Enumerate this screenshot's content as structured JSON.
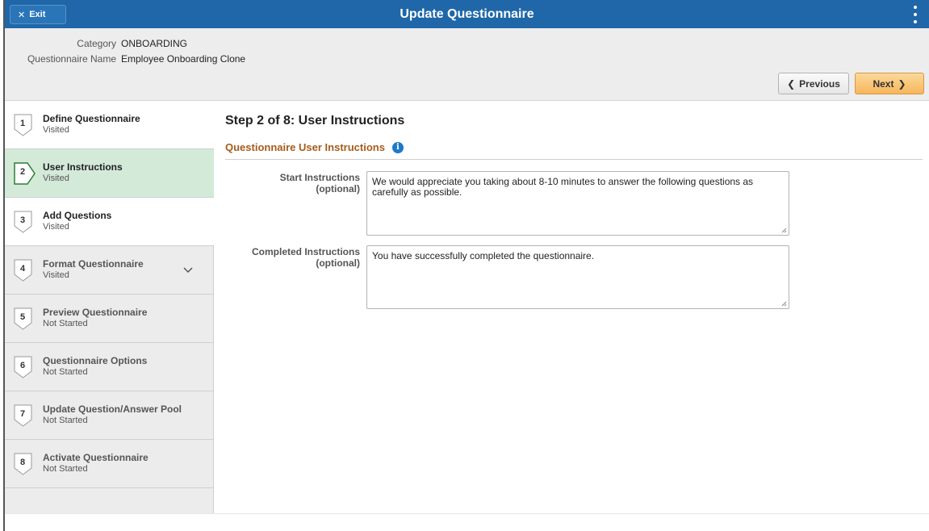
{
  "app": {
    "title": "Update Questionnaire",
    "exit_label": "Exit"
  },
  "header": {
    "category_label": "Category",
    "category_value": "ONBOARDING",
    "name_label": "Questionnaire Name",
    "name_value": "Employee Onboarding Clone"
  },
  "nav": {
    "previous_label": "Previous",
    "next_label": "Next"
  },
  "steps": [
    {
      "number": "1",
      "title": "Define Questionnaire",
      "status": "Visited"
    },
    {
      "number": "2",
      "title": "User Instructions",
      "status": "Visited"
    },
    {
      "number": "3",
      "title": "Add Questions",
      "status": "Visited"
    },
    {
      "number": "4",
      "title": "Format Questionnaire",
      "status": "Visited"
    },
    {
      "number": "5",
      "title": "Preview Questionnaire",
      "status": "Not Started"
    },
    {
      "number": "6",
      "title": "Questionnaire Options",
      "status": "Not Started"
    },
    {
      "number": "7",
      "title": "Update Question/Answer Pool",
      "status": "Not Started"
    },
    {
      "number": "8",
      "title": "Activate Questionnaire",
      "status": "Not Started"
    }
  ],
  "main": {
    "heading": "Step 2 of 8: User Instructions",
    "section_title": "Questionnaire User Instructions",
    "start_label": "Start Instructions",
    "start_optional": "(optional)",
    "start_value": "We would appreciate you taking about 8-10 minutes to answer the following questions as carefully as possible.",
    "completed_label": "Completed Instructions",
    "completed_optional": "(optional)",
    "completed_value": "You have successfully completed the questionnaire."
  },
  "colors": {
    "banner": "#1f67a8",
    "active_step": "#d3ead9",
    "section_title": "#a55c1b",
    "next_button": "#f6b65b"
  }
}
